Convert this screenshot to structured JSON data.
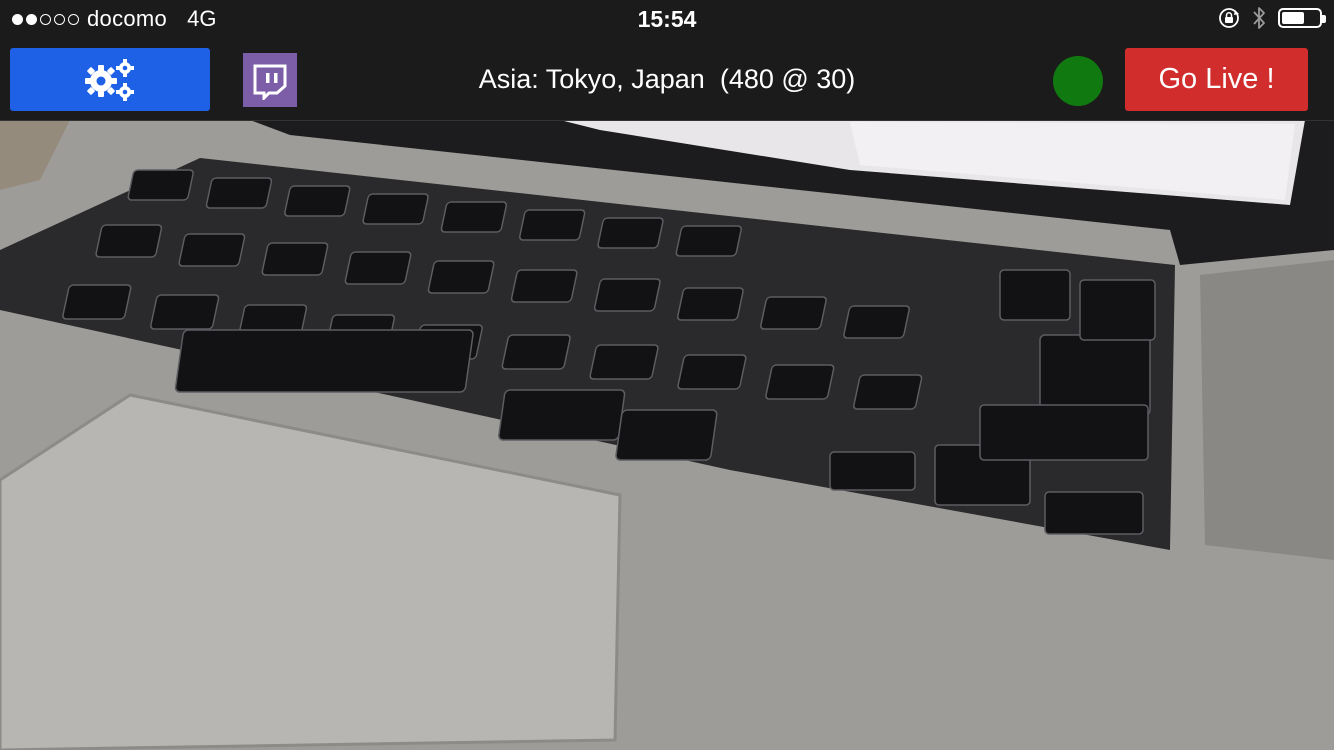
{
  "status_bar": {
    "signal_bars_filled": 2,
    "signal_bars_total": 5,
    "carrier": "docomo",
    "network": "4G",
    "time": "15:54",
    "icons": [
      "rotation-lock-icon",
      "bluetooth-icon",
      "battery-icon"
    ],
    "battery_level": 0.6
  },
  "toolbar": {
    "settings_icon": "gears-icon",
    "twitch_icon": "twitch-icon",
    "server_label": "Asia: Tokyo, Japan  (480 @ 30)",
    "status_indicator_color": "#107a10",
    "go_live_label": "Go Live !"
  },
  "colors": {
    "settings_button": "#1e60e6",
    "twitch_button": "#7b5ea7",
    "go_live_button": "#d12d2d",
    "bar_background": "#1b1b1b"
  }
}
